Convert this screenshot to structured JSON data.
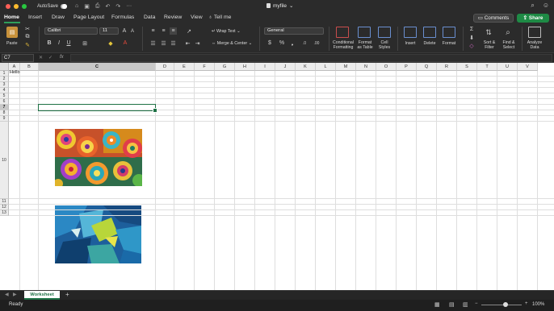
{
  "titlebar": {
    "autosave_label": "AutoSave",
    "doc_title": "myfile",
    "traffic_colors": [
      "#ff5f57",
      "#febc2e",
      "#28c840"
    ]
  },
  "tabs": [
    "Home",
    "Insert",
    "Draw",
    "Page Layout",
    "Formulas",
    "Data",
    "Review",
    "View"
  ],
  "tell_me": "Tell me",
  "buttons": {
    "comments": "Comments",
    "share": "Share"
  },
  "ribbon": {
    "paste": "Paste",
    "font_name": "Calibri",
    "font_size": "11",
    "wrap_text": "Wrap Text",
    "merge_center": "Merge & Center",
    "number_format": "General",
    "conditional_formatting": [
      "Conditional",
      "Formatting"
    ],
    "format_as_table": [
      "Format",
      "as Table"
    ],
    "cell_styles": [
      "Cell",
      "Styles"
    ],
    "insert": "Insert",
    "delete": "Delete",
    "format": "Format",
    "sort_filter": [
      "Sort &",
      "Filter"
    ],
    "find_select": [
      "Find &",
      "Select"
    ],
    "analyze_data": [
      "Analyze",
      "Data"
    ]
  },
  "formula_bar": {
    "name_box": "C7",
    "fx": "fx",
    "value": ""
  },
  "columns": [
    "A",
    "B",
    "C",
    "D",
    "E",
    "F",
    "G",
    "H",
    "I",
    "J",
    "K",
    "L",
    "M",
    "N",
    "O",
    "P",
    "Q",
    "R",
    "S",
    "T",
    "U",
    "V"
  ],
  "rows": [
    "1",
    "2",
    "3",
    "4",
    "5",
    "6",
    "7",
    "8",
    "9",
    "10",
    "11",
    "12",
    "13"
  ],
  "selected_cell": "C7",
  "cells": {
    "A1": "Hello"
  },
  "images": [
    {
      "name": "colorful-mandala-image"
    },
    {
      "name": "blue-abstract-paint-image"
    }
  ],
  "sheet": {
    "tab": "Worksheet",
    "add": "+"
  },
  "status": {
    "ready": "Ready",
    "zoom": "100%",
    "zoom_fraction": 0.6
  }
}
